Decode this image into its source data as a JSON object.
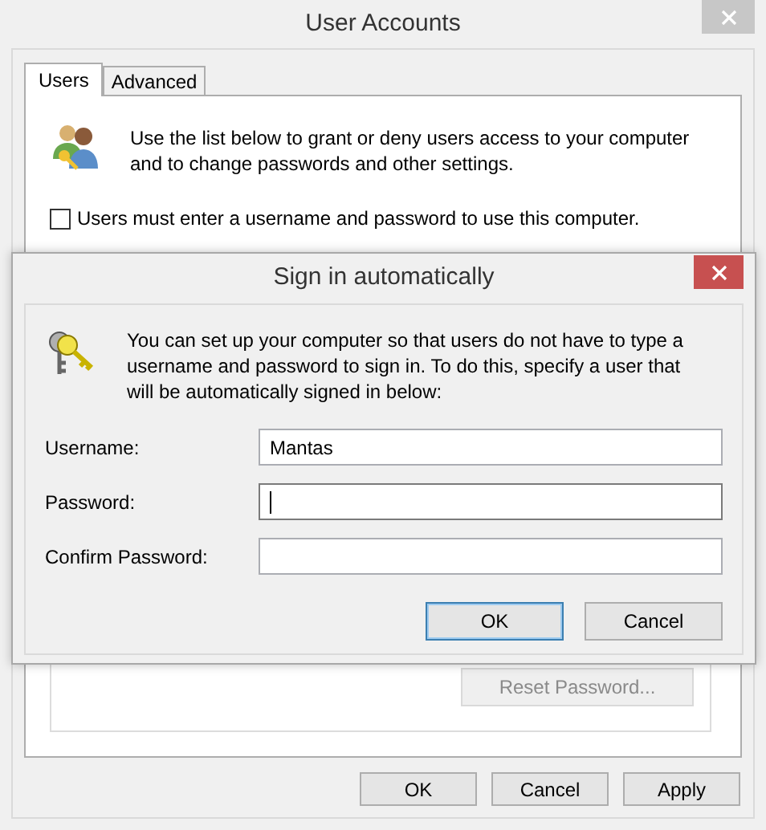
{
  "window": {
    "title": "User Accounts"
  },
  "tabs": [
    {
      "label": "Users",
      "selected": true
    },
    {
      "label": "Advanced",
      "selected": false
    }
  ],
  "users_tab": {
    "description": "Use the list below to grant or deny users access to your computer and to change passwords and other settings.",
    "require_password": {
      "label": "Users must enter a username and password to use this computer.",
      "checked": false
    },
    "reset_password_button": {
      "label": "Reset Password...",
      "disabled": true
    }
  },
  "buttons": [
    {
      "label": "OK",
      "disabled": false
    },
    {
      "label": "Cancel",
      "disabled": false
    },
    {
      "label": "Apply",
      "disabled": false
    }
  ],
  "dialog": {
    "title": "Sign in automatically",
    "description": "You can set up your computer so that users do not have to type a username and password to sign in. To do this, specify a user that will be automatically signed in below:",
    "fields": [
      {
        "label": "Username:",
        "value": "Mantas",
        "focused": false
      },
      {
        "label": "Password:",
        "focused": true
      },
      {
        "label": "Confirm Password:",
        "focused": false
      }
    ],
    "buttons": [
      {
        "label": "OK",
        "default": true
      },
      {
        "label": "Cancel",
        "default": false
      }
    ]
  }
}
